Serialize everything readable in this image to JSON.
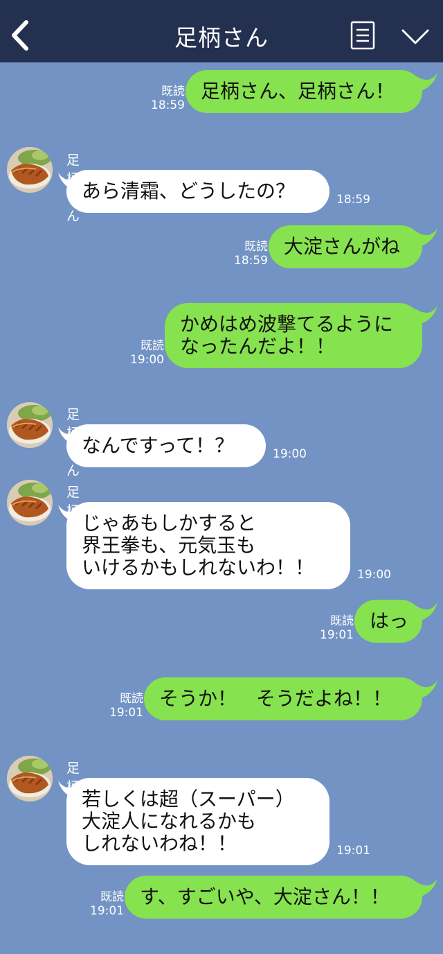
{
  "header": {
    "title": "足柄さん"
  },
  "read_label": "既読",
  "messages": [
    {
      "type": "out",
      "text": "足柄さん、足柄さん！",
      "time": "18:59",
      "read": "既読"
    },
    {
      "type": "in",
      "sender": "足柄さん",
      "text": "あら清霜、どうしたの？",
      "time": "18:59"
    },
    {
      "type": "out",
      "text": "大淀さんがね",
      "time": "18:59",
      "read": "既読"
    },
    {
      "type": "out",
      "text": "かめはめ波撃てるように\nなったんだよ！！",
      "time": "19:00",
      "read": "既読"
    },
    {
      "type": "in",
      "sender": "足柄さん",
      "text": "なんですって！？",
      "time": "19:00"
    },
    {
      "type": "in",
      "sender": "足柄さん",
      "text": "じゃあもしかすると\n界王拳も、元気玉も\nいけるかもしれないわ！！",
      "time": "19:00"
    },
    {
      "type": "out",
      "text": "はっ",
      "time": "19:01",
      "read": "既読"
    },
    {
      "type": "out",
      "text": "そうか！　そうだよね！！",
      "time": "19:01",
      "read": "既読"
    },
    {
      "type": "in",
      "sender": "足柄さん",
      "text": "若しくは超（スーパー）\n大淀人になれるかも\nしれないわね！！",
      "time": "19:01"
    },
    {
      "type": "out",
      "text": "す、すごいや、大淀さん！！",
      "time": "19:01",
      "read": "既読"
    }
  ]
}
